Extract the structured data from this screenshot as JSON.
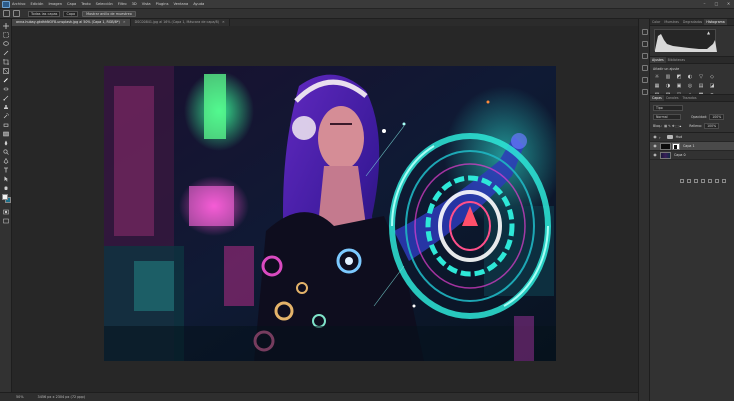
{
  "app": {
    "menus": [
      "Archivo",
      "Edición",
      "Imagen",
      "Capa",
      "Texto",
      "Selección",
      "Filtro",
      "3D",
      "Vista",
      "Plugins",
      "Ventana",
      "Ayuda"
    ],
    "window_controls": [
      "–",
      "□",
      "✕"
    ]
  },
  "options_bar": {
    "sample_label": "Todas las capas",
    "layer_sample": "Capa",
    "mode_label": "Mostrar anillo de muestreo"
  },
  "document_tabs": [
    {
      "label": "anna-hubay-gkdhhNOF8-unsplash.jpg al 50% (Capa 1, RGB/8*)",
      "active": true
    },
    {
      "label": "DSC00841.jpg al 16% (Capa 1, Máscara de capa/8)",
      "active": false
    }
  ],
  "statusbar": {
    "zoom": "50%",
    "doc_info": "3456 px x 2304 px (72 ppp)"
  },
  "panels": {
    "top_tabs": [
      "Color",
      "Muestras",
      "Degradados",
      "Histograma"
    ],
    "adjust_tabs": [
      "Ajustes",
      "Bibliotecas"
    ],
    "adjust_label": "Añadir un ajuste",
    "adjust_icons": [
      "☼",
      "▥",
      "◩",
      "◐",
      "▽",
      "◇",
      "▦",
      "◑",
      "▣",
      "◎",
      "▤",
      "◪",
      "▧",
      "▨",
      "◫",
      "◬",
      "▩",
      "▪"
    ],
    "layers_tabs": [
      "Capas",
      "Canales",
      "Trazados"
    ],
    "filter_label": "Tipo",
    "blend_mode": "Normal",
    "opacity_label": "Opacidad:",
    "opacity_value": "100%",
    "lock_label": "Bloq.:",
    "fill_label": "Relleno:",
    "fill_value": "100%"
  },
  "layers": [
    {
      "name": "Hud",
      "kind": "group",
      "selected": false
    },
    {
      "name": "Capa 1",
      "kind": "mask",
      "selected": true
    },
    {
      "name": "Capa 0",
      "kind": "image",
      "selected": false
    }
  ],
  "colors": {
    "accent_cyan": "#2ee8d8",
    "accent_magenta": "#e23fd0",
    "foreground": "#f2f2f2",
    "background": "#1b6f8a"
  }
}
